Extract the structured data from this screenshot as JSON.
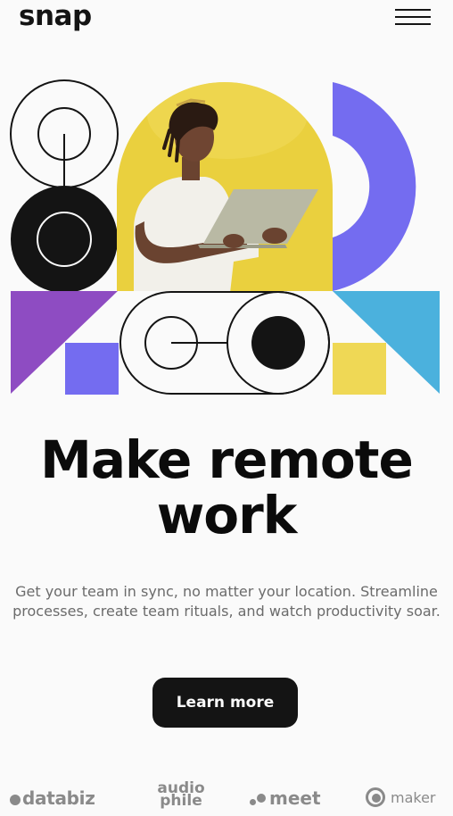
{
  "header": {
    "logo": "snap",
    "menu_icon": "hamburger-menu-icon"
  },
  "hero": {
    "image_alt": "Person with dreadlocks working on a laptop against a yellow background",
    "colors": {
      "purple": "#8e4cc2",
      "indigo": "#746cf0",
      "yellow": "#efd855",
      "photo_yellow": "#ead03e",
      "blue": "#4bb1dd",
      "black": "#141414"
    }
  },
  "main": {
    "headline_line1": "Make remote",
    "headline_line2": "work",
    "subtext": "Get your team in sync, no matter your location. Streamline processes, create team rituals, and watch productivity soar.",
    "cta_label": "Learn more"
  },
  "clients": [
    {
      "name": "databiz",
      "icon": "databiz-logo"
    },
    {
      "name_line1": "audio",
      "name_line2": "phile",
      "icon": "audiophile-logo"
    },
    {
      "name": "meet",
      "icon": "meet-logo"
    },
    {
      "name": "maker",
      "icon": "maker-logo"
    }
  ]
}
